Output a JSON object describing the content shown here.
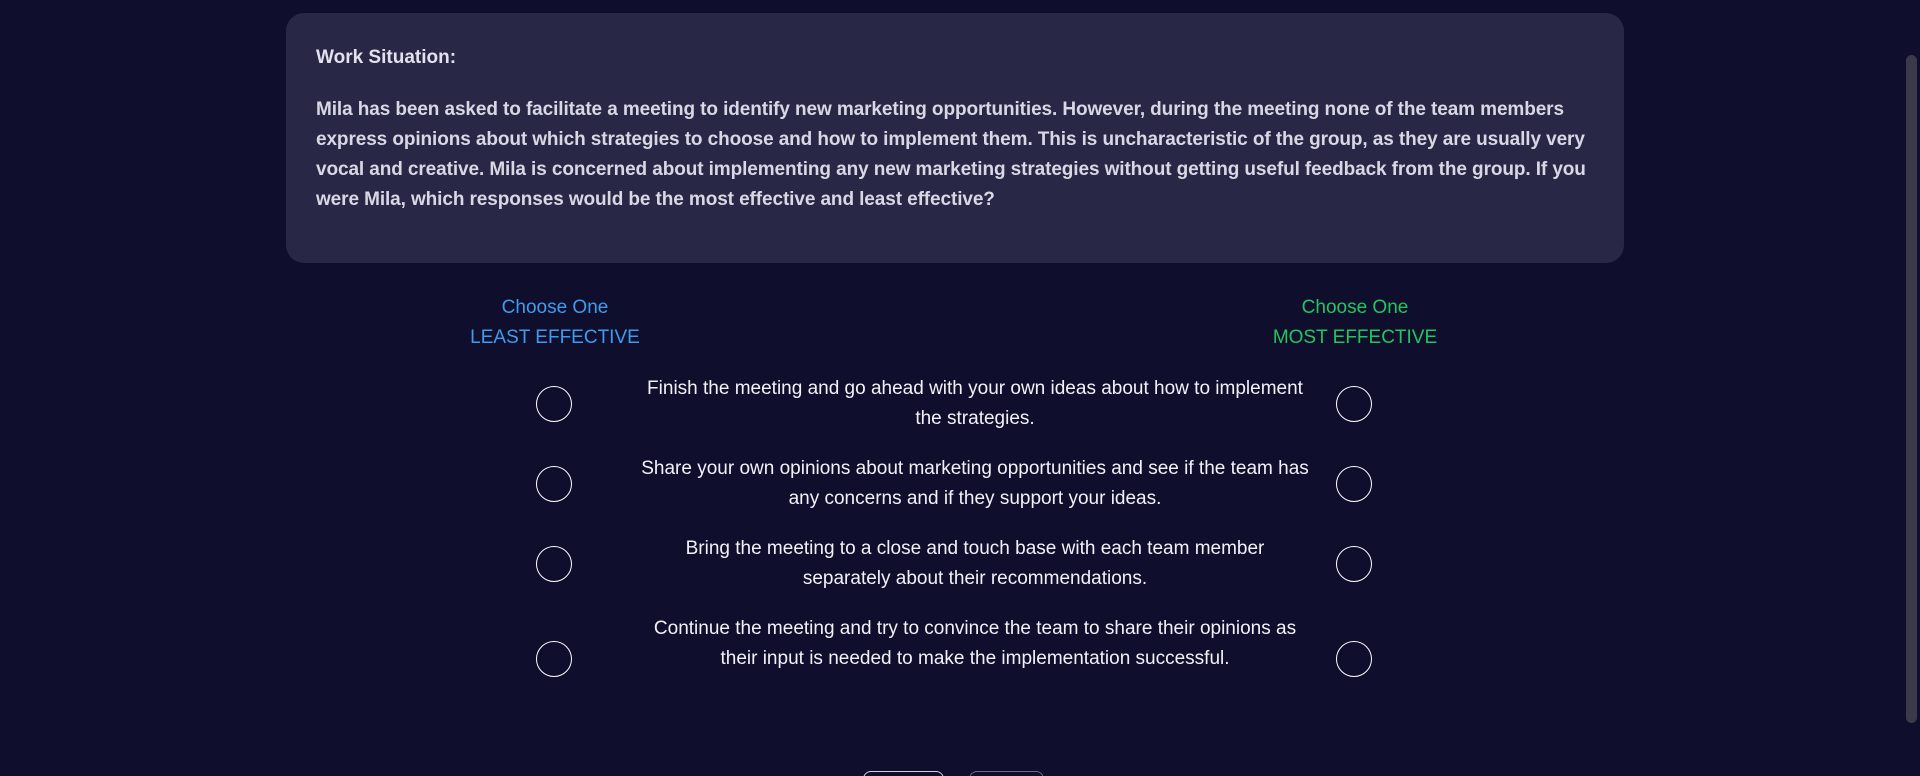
{
  "situation": {
    "title": "Work Situation:",
    "text": "Mila has been asked to facilitate a meeting to identify new marketing opportunities. However, during the meeting none of the team members express opinions about which strategies to choose and how to implement them. This is uncharacteristic of the group, as they are usually very vocal and creative. Mila is concerned about implementing any new marketing strategies without getting useful feedback from the group. If you were Mila, which responses would be the most effective and least effective?"
  },
  "columns": {
    "least": {
      "line1": "Choose One",
      "line2": "LEAST EFFECTIVE",
      "color": "#3f9bf0"
    },
    "most": {
      "line1": "Choose One",
      "line2": "MOST EFFECTIVE",
      "color": "#22c55e"
    }
  },
  "options": [
    {
      "text": "Finish the meeting and go ahead with your own ideas about how to implement the strategies."
    },
    {
      "text": "Share your own opinions about marketing opportunities and see if the team has any concerns and if they support your ideas."
    },
    {
      "text": "Bring the meeting to a close and touch base with each team member separately about their recommendations."
    },
    {
      "text": "Continue the meeting and try to convince the team to share their opinions as their input is needed to make the implementation successful."
    }
  ],
  "colors": {
    "background": "#0f0e2c",
    "card": "#282746"
  }
}
